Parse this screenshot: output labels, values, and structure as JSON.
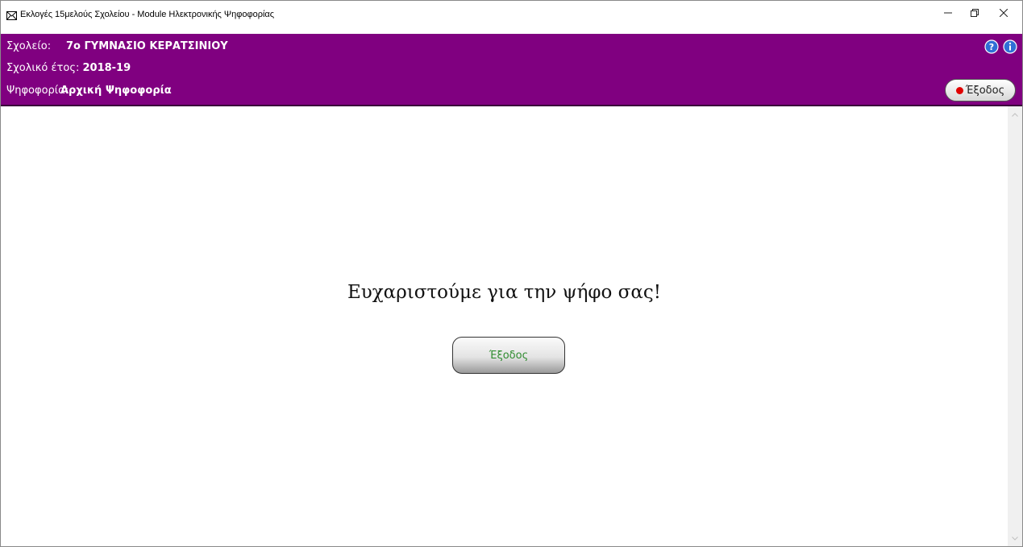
{
  "window": {
    "title": "Εκλογές 15μελούς Σχολείου - Module Ηλεκτρονικής Ψηφοφορίας",
    "icons": {
      "app": "envelope-icon",
      "minimize": "minimize-icon",
      "maximize": "restore-icon",
      "close": "close-icon"
    }
  },
  "header": {
    "school_label": "Σχολείο:",
    "school_value": "7ο ΓΥΜΝΑΣΙΟ ΚΕΡΑΤΣΙΝΙΟΥ",
    "year_label": "Σχολικό έτος:",
    "year_value": "2018-19",
    "vote_label": "Ψηφοφορία:",
    "vote_value": "Αρχική Ψηφοφορία",
    "exit_label": "Έξοδος",
    "icons": {
      "help": "help-icon",
      "info": "info-icon"
    }
  },
  "main": {
    "message": "Ευχαριστούμε για την ψήφο σας!",
    "exit_label": "Έξοδος"
  },
  "colors": {
    "header_bg": "#800080",
    "exit_text": "#2e8b2e",
    "red_dot": "#e00000"
  }
}
